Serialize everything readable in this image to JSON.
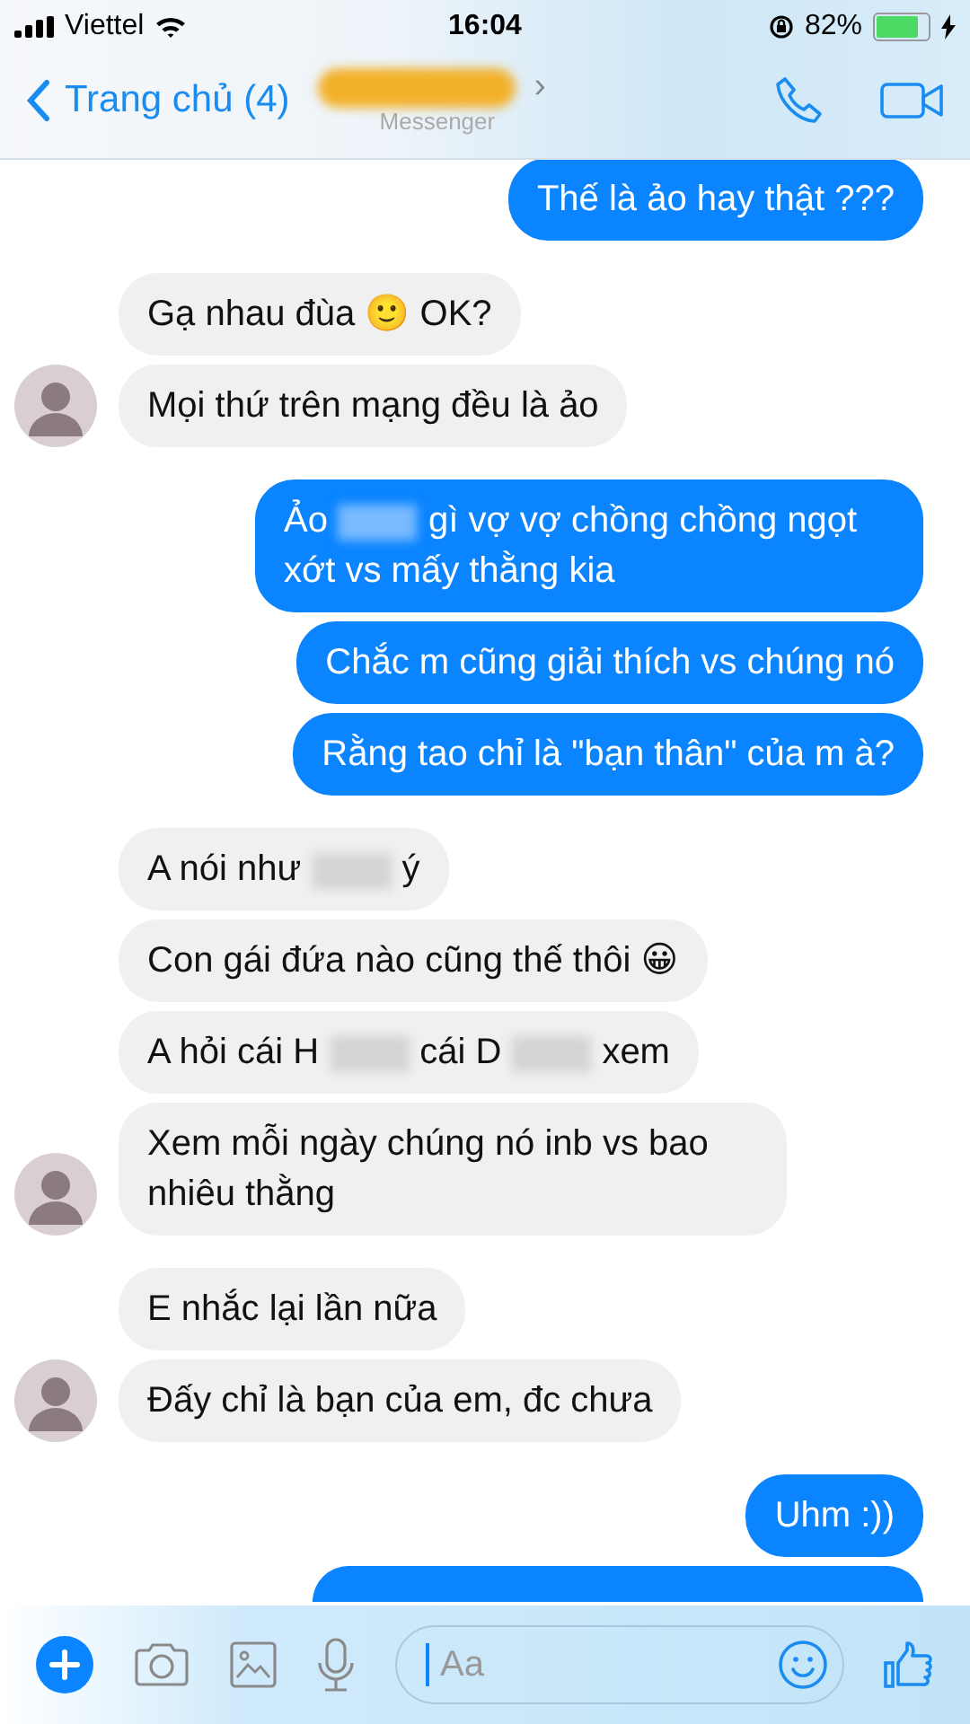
{
  "status_bar": {
    "carrier": "Viettel",
    "time": "16:04",
    "battery": "82%"
  },
  "header": {
    "back_label": "Trang chủ (4)",
    "subtitle": "Messenger",
    "chevron": "›"
  },
  "groups": [
    {
      "kind": "outgoing",
      "avatar": false,
      "messages": [
        {
          "parts": [
            "Thế là ảo hay thật ???"
          ]
        }
      ]
    },
    {
      "kind": "incoming",
      "avatar": true,
      "messages": [
        {
          "parts": [
            "Gạ nhau đùa 🙂 OK?"
          ]
        },
        {
          "parts": [
            "Mọi thứ trên mạng đều là ảo"
          ]
        }
      ]
    },
    {
      "kind": "outgoing",
      "avatar": false,
      "messages": [
        {
          "parts": [
            "Ảo",
            "gì vợ vợ chồng chồng ngọt xớt vs mấy thằng kia"
          ]
        },
        {
          "parts": [
            "Chắc m cũng giải thích vs chúng nó"
          ]
        },
        {
          "parts": [
            "Rằng tao chỉ là \"bạn thân\" của m à?"
          ]
        }
      ]
    },
    {
      "kind": "incoming",
      "avatar": true,
      "messages": [
        {
          "parts": [
            "A nói như",
            "ý"
          ]
        },
        {
          "parts": [
            "Con gái đứa nào cũng thế thôi 😀"
          ]
        },
        {
          "parts": [
            "A hỏi cái H",
            "cái D",
            "xem"
          ]
        },
        {
          "parts": [
            "Xem mỗi ngày chúng nó inb vs bao nhiêu thằng"
          ]
        }
      ]
    },
    {
      "kind": "incoming",
      "avatar": true,
      "messages": [
        {
          "parts": [
            "E nhắc lại lần nữa"
          ]
        },
        {
          "parts": [
            "Đấy chỉ là bạn của em, đc chưa"
          ]
        }
      ]
    },
    {
      "kind": "outgoing",
      "avatar": false,
      "messages": [
        {
          "parts": [
            "Uhm :))"
          ]
        },
        {
          "partial": true
        }
      ]
    }
  ],
  "composer": {
    "placeholder": "Aa"
  }
}
